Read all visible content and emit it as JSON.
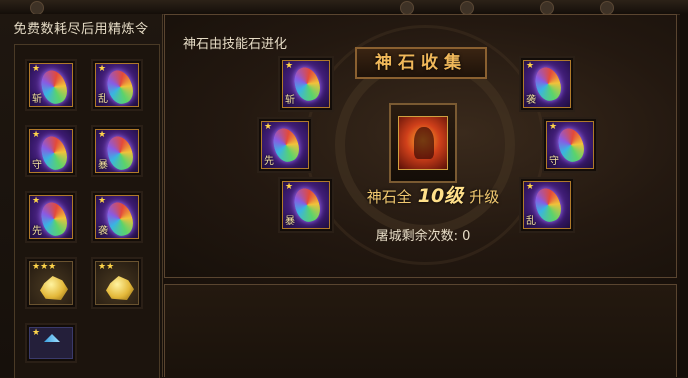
{
  "left_panel": {
    "title": "免费数耗尽后用精炼令",
    "items": [
      {
        "type": "gem",
        "stars": "★",
        "char": "斩"
      },
      {
        "type": "gem",
        "stars": "★",
        "char": "乱"
      },
      {
        "type": "gem",
        "stars": "★",
        "char": "守"
      },
      {
        "type": "gem",
        "stars": "★",
        "char": "暴"
      },
      {
        "type": "gem",
        "stars": "★",
        "char": "先"
      },
      {
        "type": "gem",
        "stars": "★",
        "char": "袭"
      },
      {
        "type": "gold",
        "stars": "★★★"
      },
      {
        "type": "gold",
        "stars": "★★"
      },
      {
        "type": "blue",
        "stars": "★"
      }
    ]
  },
  "main_panel": {
    "title": "神石由技能石进化",
    "banner": "神石收集",
    "upgrade_prefix": "神石全",
    "upgrade_level": "10级",
    "upgrade_suffix": "升级",
    "tucheng": "屠城剩余次数: 0",
    "gems": [
      {
        "position": "left-top",
        "stars": "★",
        "char": "斩"
      },
      {
        "position": "left-middle",
        "stars": "★",
        "char": "先"
      },
      {
        "position": "left-bottom",
        "stars": "★",
        "char": "暴"
      },
      {
        "position": "right-top",
        "stars": "★",
        "char": "袭"
      },
      {
        "position": "right-middle",
        "stars": "★",
        "char": "守"
      },
      {
        "position": "right-bottom",
        "stars": "★",
        "char": "乱"
      }
    ]
  }
}
